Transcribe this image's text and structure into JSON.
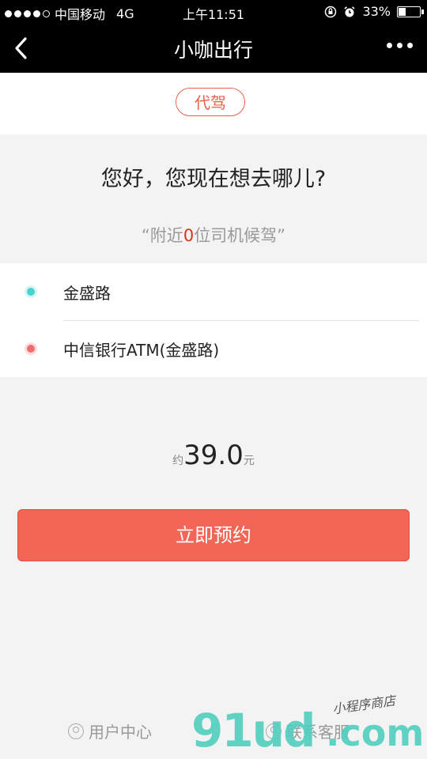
{
  "status_bar": {
    "carrier": "中国移动",
    "network": "4G",
    "time": "上午11:51",
    "battery": "33%",
    "battery_level": 0.33
  },
  "nav": {
    "title": "小咖出行"
  },
  "service_tab": {
    "label": "代驾"
  },
  "greeting": "您好，您现在想去哪儿?",
  "drivers": {
    "prefix": "“附近",
    "count": "0",
    "suffix": "位司机候驾”"
  },
  "locations": {
    "start": "金盛路",
    "end": "中信银行ATM(金盛路)"
  },
  "fare": {
    "prefix": "约",
    "value": "39.0",
    "unit": "元"
  },
  "actions": {
    "book_now": "立即预约"
  },
  "footer": {
    "user_center": "用户中心",
    "contact_service": "联系客服"
  },
  "watermark": {
    "brand": "91ud",
    "suffix": ".com",
    "tagline": "小程序商店"
  },
  "colors": {
    "accent": "#f16656",
    "start_marker": "#49d3cf",
    "end_marker": "#ef6d6d",
    "driver_count": "#e0301e"
  },
  "icons": {
    "back": "back-arrow-icon",
    "more": "more-dots-icon",
    "user": "user-icon",
    "service": "headset-icon"
  }
}
